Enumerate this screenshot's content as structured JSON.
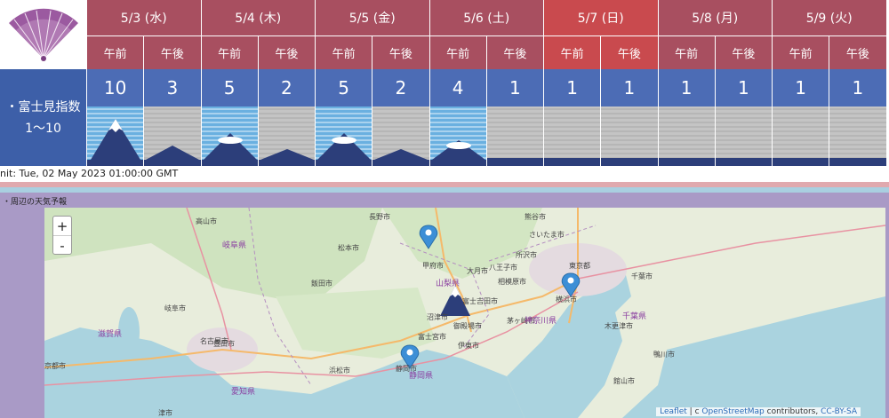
{
  "header": {
    "days": [
      {
        "date": "5/3 (水)",
        "am": "午前",
        "pm": "午後",
        "am_index": "10",
        "pm_index": "3",
        "am_view": "clear",
        "pm_view": "partial",
        "sunday": false
      },
      {
        "date": "5/4 (木)",
        "am": "午前",
        "pm": "午後",
        "am_index": "5",
        "pm_index": "2",
        "am_view": "good",
        "pm_view": "cloudy",
        "sunday": false
      },
      {
        "date": "5/5 (金)",
        "am": "午前",
        "pm": "午後",
        "am_index": "5",
        "pm_index": "2",
        "am_view": "good",
        "pm_view": "cloudy",
        "sunday": false
      },
      {
        "date": "5/6 (土)",
        "am": "午前",
        "pm": "午後",
        "am_index": "4",
        "pm_index": "1",
        "am_view": "low",
        "pm_view": "hidden",
        "sunday": false
      },
      {
        "date": "5/7 (日)",
        "am": "午前",
        "pm": "午後",
        "am_index": "1",
        "pm_index": "1",
        "am_view": "hidden",
        "pm_view": "hidden",
        "sunday": true
      },
      {
        "date": "5/8 (月)",
        "am": "午前",
        "pm": "午後",
        "am_index": "1",
        "pm_index": "1",
        "am_view": "hidden",
        "pm_view": "hidden",
        "sunday": false
      },
      {
        "date": "5/9 (火)",
        "am": "午前",
        "pm": "午後",
        "am_index": "1",
        "pm_index": "1",
        "am_view": "hidden",
        "pm_view": "hidden",
        "sunday": false
      }
    ]
  },
  "row_label": {
    "title": "・富士見指数",
    "range": "1〜10"
  },
  "unit_text": "nit: Tue, 02 May 2023 01:00:00 GMT",
  "section": {
    "title": "・周辺の天気予報"
  },
  "map": {
    "zoom_in": "+",
    "zoom_out": "-",
    "attribution": {
      "leaflet": "Leaflet",
      "sep": " | c ",
      "osm": "OpenStreetMap",
      "contributors": " contributors, ",
      "license": "CC-BY-SA"
    },
    "cities": [
      "さいたま市",
      "東京都",
      "横浜市",
      "千葉市",
      "相模原市",
      "甲府市",
      "静岡市",
      "豊田市",
      "名古屋市",
      "岐阜市",
      "京都市",
      "津市",
      "浜松市",
      "伊東市",
      "沼津市",
      "御殿場市",
      "富士吉田市",
      "大月市",
      "飯田市",
      "松本市",
      "長野市",
      "高山市",
      "館山市",
      "鴨川市",
      "木更津市",
      "茅ヶ崎市",
      "熊谷市",
      "所沢市",
      "八王子市",
      "富士宮市"
    ],
    "prefs": [
      "山梨県",
      "静岡県",
      "神奈川県",
      "千葉県",
      "岐阜県",
      "愛知県",
      "滋賀県"
    ]
  },
  "colors": {
    "header_bg": "#a84f60",
    "sunday_bg": "#c94a4e",
    "index_bg": "#4c6cb5",
    "label_bg": "#3d5fa8",
    "section_bg": "#a99ac6",
    "pin": "#3d8fd6"
  }
}
